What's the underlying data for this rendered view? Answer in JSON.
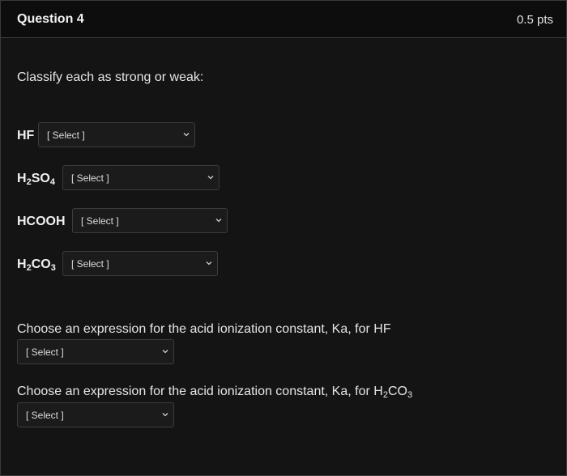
{
  "header": {
    "title": "Question 4",
    "points": "0.5 pts"
  },
  "prompt": "Classify each as strong or weak:",
  "rows": [
    {
      "label_main": "HF",
      "select_value": "[ Select ]"
    },
    {
      "label_a": "H",
      "label_sub1": "2",
      "label_b": "SO",
      "label_sub2": "4",
      "select_value": "[ Select ]"
    },
    {
      "label_main": "HCOOH",
      "select_value": "[ Select ]"
    },
    {
      "label_a": "H",
      "label_sub1": "2",
      "label_b": "CO",
      "label_sub2": "3",
      "select_value": "[ Select ]"
    }
  ],
  "ka_hf": {
    "text": "Choose an expression for the acid ionization constant, Ka, for HF",
    "select_value": "[ Select ]"
  },
  "ka_h2co3": {
    "text_a": "Choose an expression for the acid ionization constant, Ka, for H",
    "text_sub1": "2",
    "text_b": "CO",
    "text_sub2": "3",
    "select_value": "[ Select ]"
  },
  "icons": {
    "dropdown": "chevron-down-icon"
  }
}
